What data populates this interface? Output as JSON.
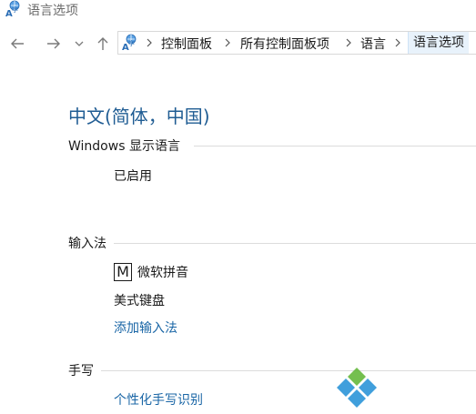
{
  "window": {
    "title": "语言选项",
    "icon": "language-options-icon"
  },
  "navigation": {
    "back_icon": "arrow-left-icon",
    "forward_icon": "arrow-right-icon",
    "recent_icon": "chevron-down-icon",
    "up_icon": "arrow-up-icon"
  },
  "address_bar": {
    "breadcrumbs": [
      "控制面板",
      "所有控制面板项",
      "语言"
    ],
    "current": "语言选项",
    "separator_icon": "chevron-right-icon"
  },
  "language": {
    "title": "中文(简体，中国)"
  },
  "sections": {
    "display_language": {
      "label": "Windows 显示语言",
      "status": "已启用"
    },
    "input_method": {
      "label": "输入法",
      "ime_glyph": "M",
      "items": [
        "微软拼音",
        "美式键盘"
      ],
      "add_link": "添加输入法"
    },
    "handwriting": {
      "label": "手写",
      "link": "个性化手写识别"
    }
  },
  "colors": {
    "title_blue": "#1f5c93",
    "link_blue": "#1a66a6",
    "divider": "#dcdcdc"
  }
}
